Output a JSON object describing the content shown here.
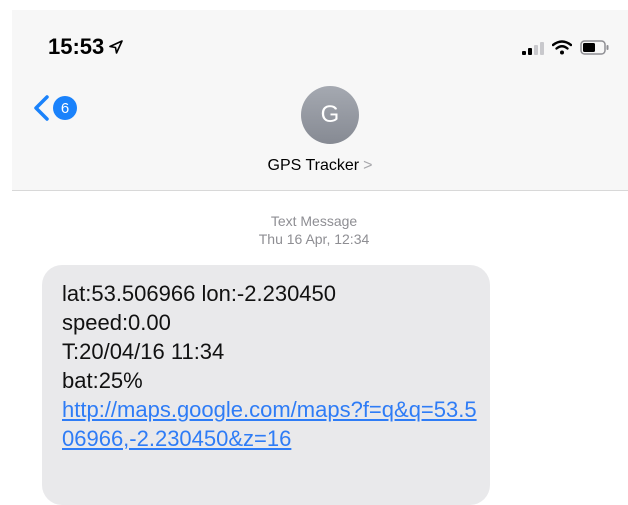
{
  "status": {
    "time": "15:53",
    "location_icon": "location-arrow-icon",
    "signal_icon": "cellular-signal-icon",
    "wifi_icon": "wifi-icon",
    "battery_icon": "battery-icon",
    "battery_level": 0.6
  },
  "header": {
    "back_icon": "chevron-left-icon",
    "unread_count": "6",
    "avatar_initial": "G",
    "contact_name": "GPS Tracker",
    "contact_chevron": ">"
  },
  "conversation": {
    "service": "Text Message",
    "timestamp": "Thu 16 Apr, 12:34"
  },
  "message": {
    "line1": "lat:53.506966 lon:-2.230450",
    "line2": "speed:0.00",
    "line3": "T:20/04/16 11:34",
    "line4": "bat:25%",
    "link": "http://maps.google.com/maps?f=q&q=53.506966,-2.230450&z=16"
  },
  "colors": {
    "accent": "#1a82fb",
    "bubble": "#e9e9eb",
    "header_bg": "#f7f7f7",
    "link": "#2e7cf6"
  }
}
